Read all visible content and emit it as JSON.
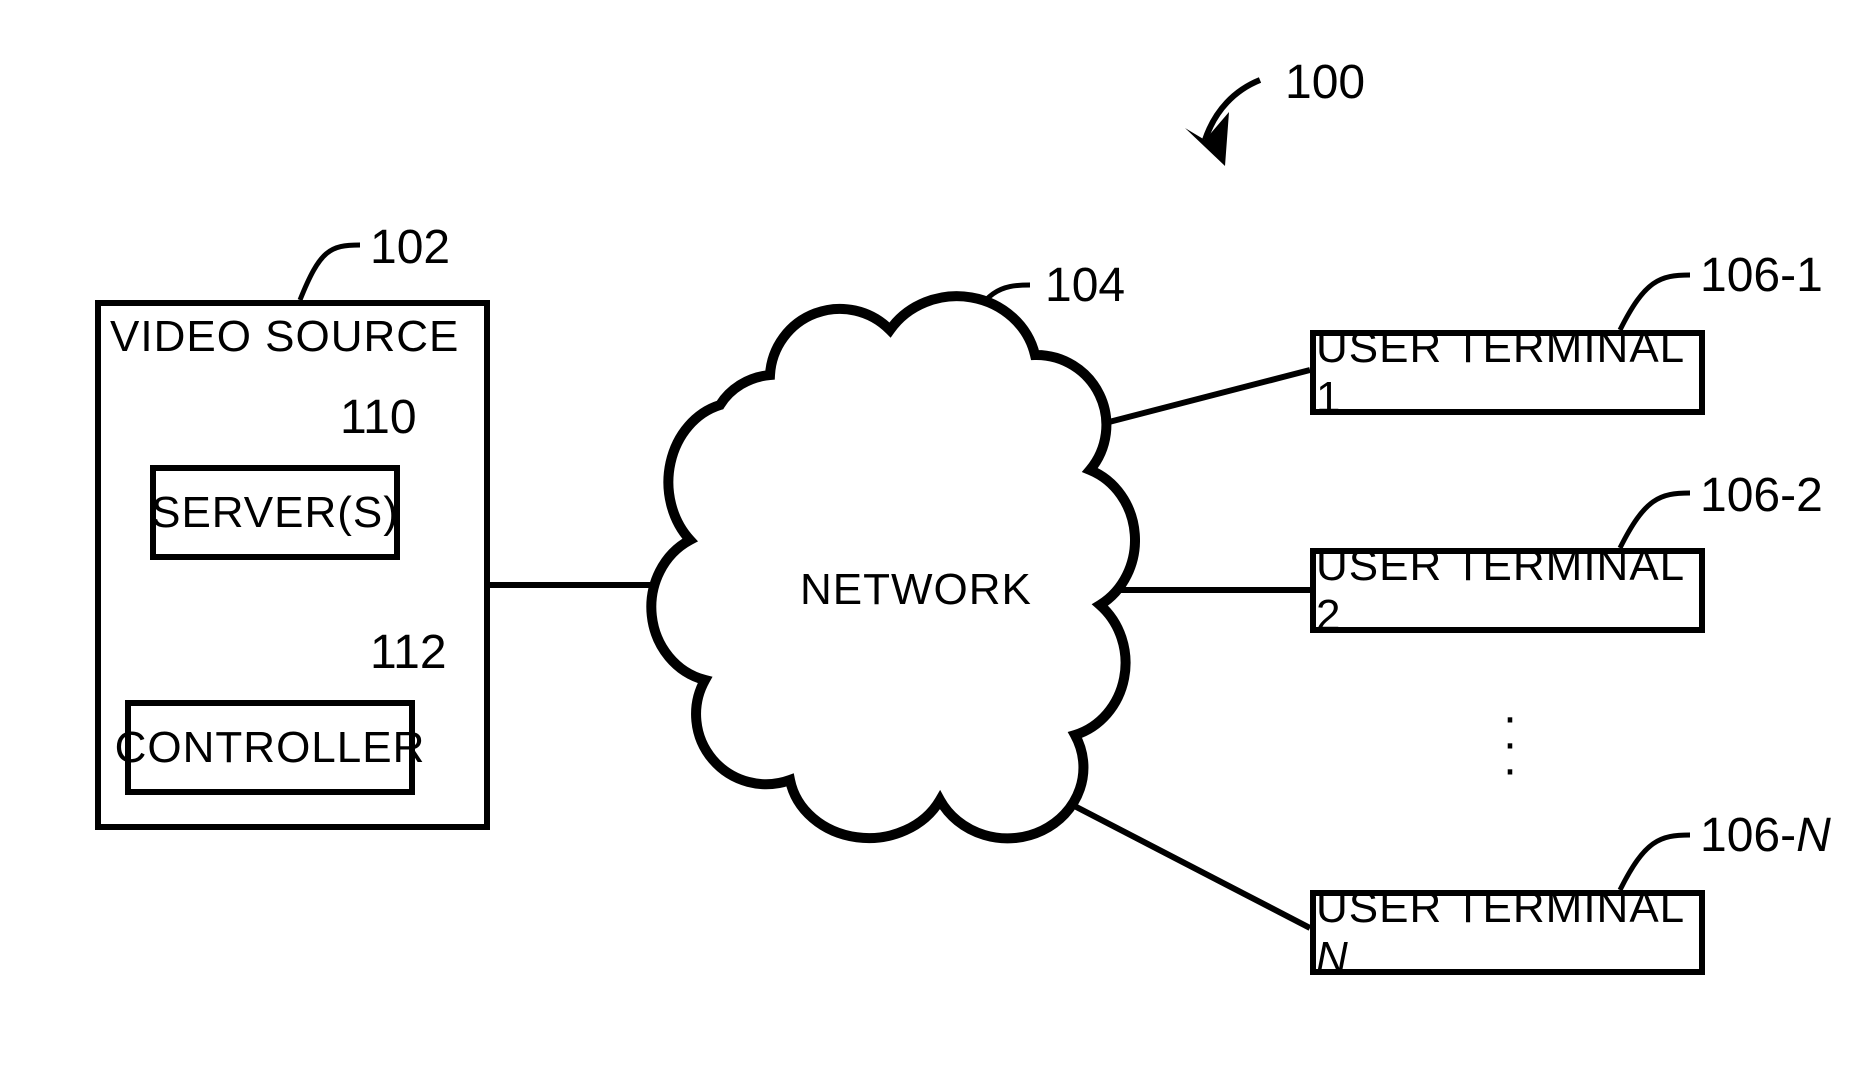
{
  "diagram": {
    "system_ref": "100",
    "video_source": {
      "ref": "102",
      "title": "VIDEO SOURCE",
      "server": {
        "ref": "110",
        "label": "SERVER(S)"
      },
      "controller": {
        "ref": "112",
        "label": "CONTROLLER"
      }
    },
    "network": {
      "ref": "104",
      "label": "NETWORK"
    },
    "terminals": {
      "t1": {
        "ref": "106-1",
        "label": "USER TERMINAL 1"
      },
      "t2": {
        "ref": "106-2",
        "label": "USER TERMINAL 2"
      },
      "tn": {
        "ref_prefix": "106-",
        "ref_var": "N",
        "label_prefix": "USER TERMINAL ",
        "label_var": "N"
      }
    }
  }
}
